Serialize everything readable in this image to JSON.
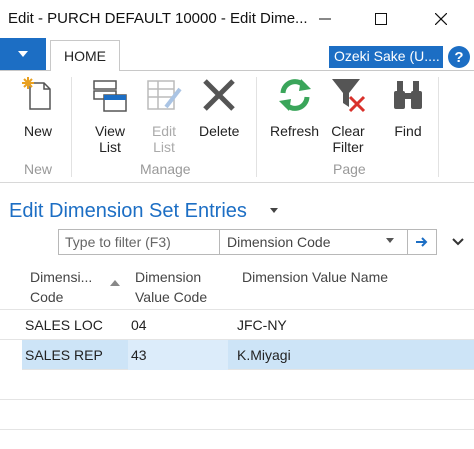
{
  "window": {
    "title": "Edit - PURCH DEFAULT 10000 - Edit Dime...",
    "minimize_icon": "minimize-icon",
    "maximize_icon": "maximize-icon",
    "close_icon": "close-icon"
  },
  "ribbon": {
    "tab_home": "HOME",
    "company": "Ozeki Sake (U....",
    "help": "?",
    "buttons": [
      {
        "label": "New",
        "icon": "new-document-icon"
      },
      {
        "label": "View\nList",
        "icon": "view-list-icon"
      },
      {
        "label": "Edit\nList",
        "icon": "edit-list-icon",
        "disabled": true
      },
      {
        "label": "Delete",
        "icon": "delete-icon"
      },
      {
        "label": "Refresh",
        "icon": "refresh-icon"
      },
      {
        "label": "Clear\nFilter",
        "icon": "clear-filter-icon"
      },
      {
        "label": "Find",
        "icon": "binoculars-icon"
      }
    ],
    "groups": [
      "New",
      "Manage",
      "Page"
    ]
  },
  "page": {
    "title": "Edit Dimension Set Entries"
  },
  "filter": {
    "placeholder": "Type to filter (F3)",
    "field": "Dimension Code"
  },
  "grid": {
    "columns": [
      "Dimensi...\nCode",
      "Dimension\nValue Code",
      "Dimension Value Name"
    ],
    "rows": [
      {
        "code": "SALES LOC",
        "value_code": "04",
        "value_name": "JFC-NY",
        "selected": false
      },
      {
        "code": "SALES REP",
        "value_code": "43",
        "value_name": "K.Miyagi",
        "selected": true
      }
    ]
  },
  "colors": {
    "accent": "#1c6ec4",
    "selected_row": "#cde4f7"
  }
}
